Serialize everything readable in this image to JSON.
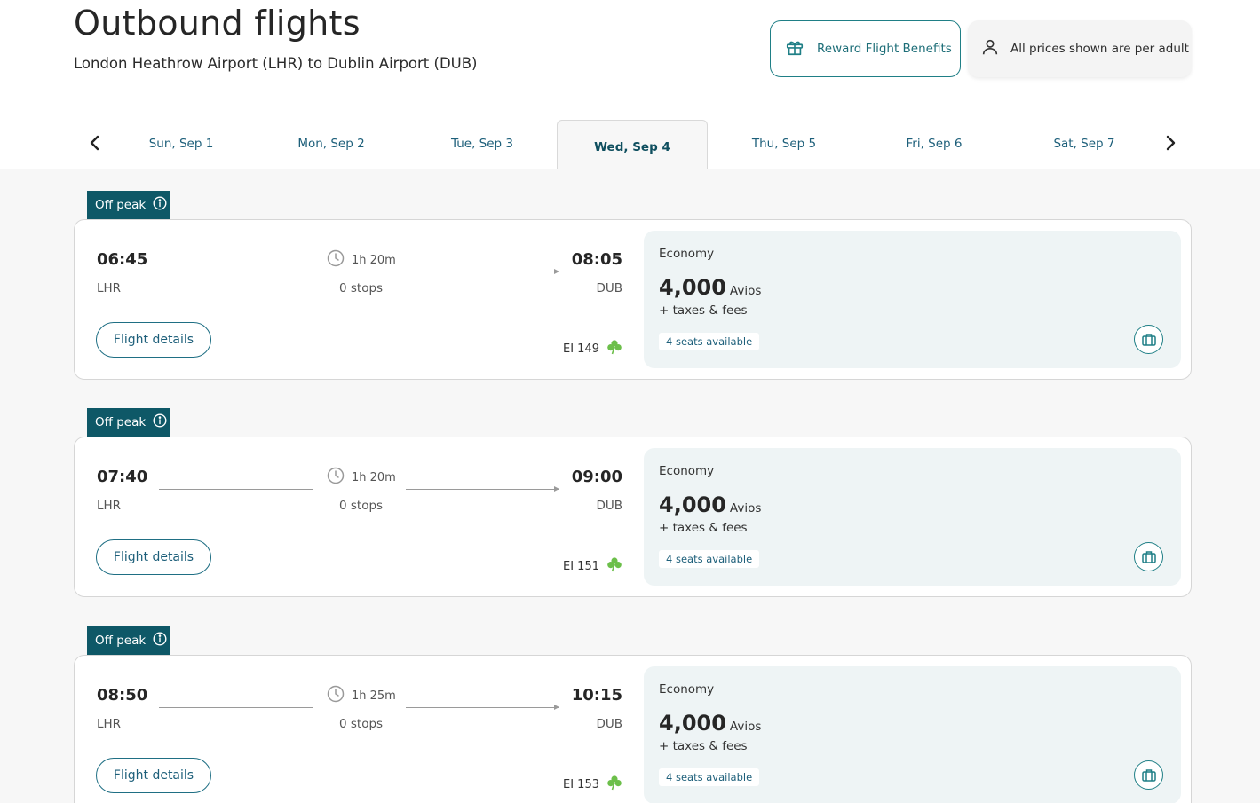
{
  "header": {
    "title": "Outbound flights",
    "route": "London Heathrow Airport (LHR) to Dublin Airport (DUB)",
    "reward_button": "Reward Flight Benefits",
    "price_note": "All prices shown are per adult"
  },
  "dates": [
    {
      "label": "Sun, Sep 1"
    },
    {
      "label": "Mon, Sep 2"
    },
    {
      "label": "Tue, Sep 3"
    },
    {
      "label": "Wed, Sep 4",
      "selected": true
    },
    {
      "label": "Thu, Sep 5"
    },
    {
      "label": "Fri, Sep 6"
    },
    {
      "label": "Sat, Sep 7"
    }
  ],
  "flights": [
    {
      "badge": "Off peak",
      "departure_time": "06:45",
      "departure_code": "LHR",
      "arrival_time": "08:05",
      "arrival_code": "DUB",
      "duration": "1h 20m",
      "stops": "0 stops",
      "details_label": "Flight details",
      "flight_number": "EI 149",
      "fare": {
        "cabin": "Economy",
        "amount": "4,000",
        "unit": "Avios",
        "taxes": "+ taxes & fees",
        "seats": "4 seats available"
      }
    },
    {
      "badge": "Off peak",
      "departure_time": "07:40",
      "departure_code": "LHR",
      "arrival_time": "09:00",
      "arrival_code": "DUB",
      "duration": "1h 20m",
      "stops": "0 stops",
      "details_label": "Flight details",
      "flight_number": "EI 151",
      "fare": {
        "cabin": "Economy",
        "amount": "4,000",
        "unit": "Avios",
        "taxes": "+ taxes & fees",
        "seats": "4 seats available"
      }
    },
    {
      "badge": "Off peak",
      "departure_time": "08:50",
      "departure_code": "LHR",
      "arrival_time": "10:15",
      "arrival_code": "DUB",
      "duration": "1h 25m",
      "stops": "0 stops",
      "details_label": "Flight details",
      "flight_number": "EI 153",
      "fare": {
        "cabin": "Economy",
        "amount": "4,000",
        "unit": "Avios",
        "taxes": "+ taxes & fees",
        "seats": "4 seats available"
      }
    }
  ],
  "icons": {
    "reward": "gift-icon",
    "price_note": "person-icon",
    "prev": "chevron-left-icon",
    "next": "chevron-right-icon",
    "badge_info": "info-icon",
    "duration": "clock-icon",
    "airline": "shamrock-icon",
    "fare": "luggage-icon"
  },
  "colors": {
    "brand_teal": "#0e5867",
    "accent": "#1f7f86",
    "fare_background": "#eef4f5",
    "shamrock": "#6cbf4a"
  }
}
